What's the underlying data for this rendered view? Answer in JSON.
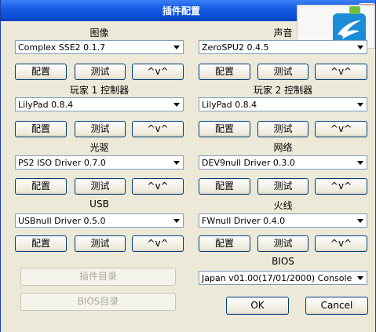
{
  "window": {
    "title": "插件配置"
  },
  "sections": {
    "graphics": {
      "label": "图像",
      "value": "Complex  SSE2 0.1.7"
    },
    "sound": {
      "label": "声音",
      "value": "ZeroSPU2  0.4.5"
    },
    "pad1": {
      "label": "玩家 1 控制器",
      "value": "LilyPad 0.8.4"
    },
    "pad2": {
      "label": "玩家 2 控制器",
      "value": "LilyPad 0.8.4"
    },
    "cdvd": {
      "label": "光驱",
      "value": "PS2 ISO Driver 0.7.0"
    },
    "dev9": {
      "label": "网络",
      "value": "DEV9null Driver 0.3.0"
    },
    "usb": {
      "label": "USB",
      "value": "USBnull Driver 0.5.0"
    },
    "firewire": {
      "label": "火线",
      "value": "FWnull Driver 0.4.0"
    },
    "bios": {
      "label": "BIOS",
      "value": "Japan  v01.00(17/01/2000) Console"
    }
  },
  "buttons": {
    "configure": "配置",
    "test": "测试",
    "about": "^v^",
    "plugins_dir": "插件目录",
    "bios_dir": "BIOS目录",
    "ok": "OK",
    "cancel": "Cancel"
  }
}
